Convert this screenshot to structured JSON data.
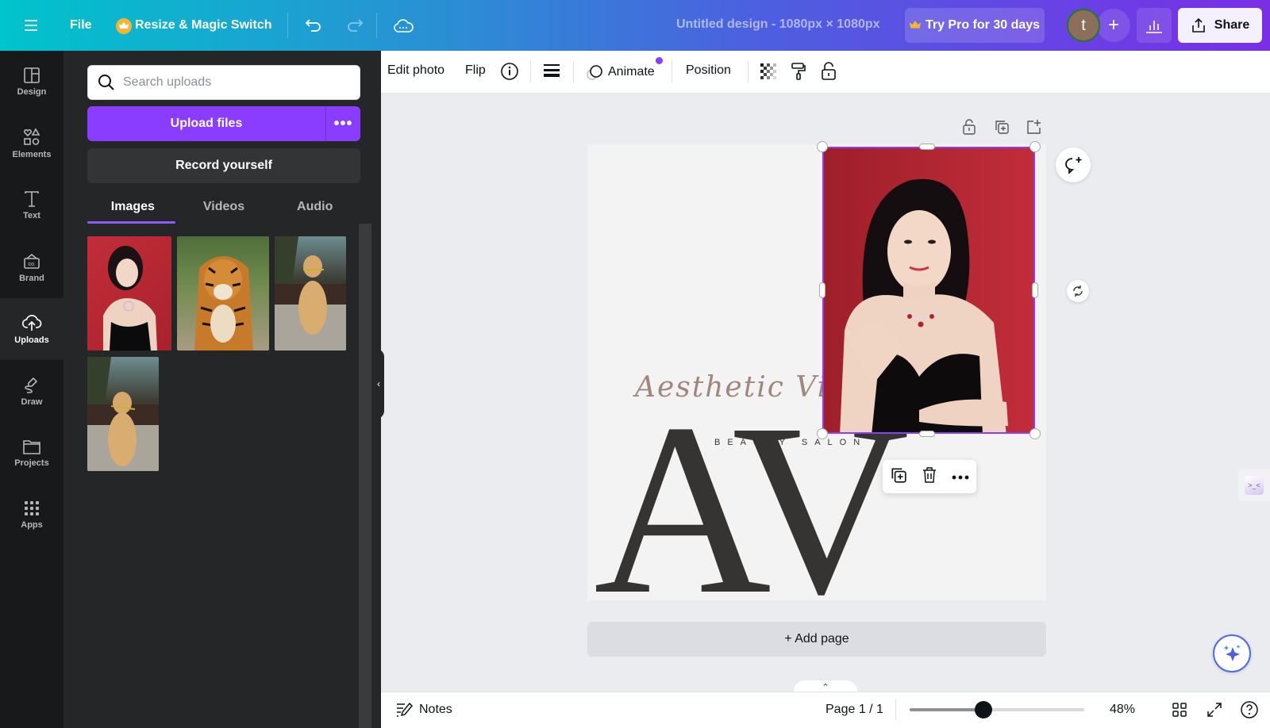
{
  "topbar": {
    "menu_icon": "hamburger-icon",
    "file_label": "File",
    "resize_label": "Resize & Magic Switch",
    "design_title": "Untitled design - 1080px × 1080px",
    "try_pro_label": "Try Pro for 30 days",
    "avatar_initial": "t",
    "add_label": "+",
    "share_label": "Share"
  },
  "leftnav": {
    "items": [
      {
        "label": "Design",
        "icon": "design-icon"
      },
      {
        "label": "Elements",
        "icon": "elements-icon"
      },
      {
        "label": "Text",
        "icon": "text-icon"
      },
      {
        "label": "Brand",
        "icon": "brand-icon"
      },
      {
        "label": "Uploads",
        "icon": "uploads-icon",
        "active": true
      },
      {
        "label": "Draw",
        "icon": "draw-icon"
      },
      {
        "label": "Projects",
        "icon": "projects-icon"
      },
      {
        "label": "Apps",
        "icon": "apps-icon"
      }
    ]
  },
  "panel": {
    "search_placeholder": "Search uploads",
    "search_value": "",
    "upload_label": "Upload files",
    "upload_more": "•••",
    "record_label": "Record yourself",
    "tabs": [
      {
        "label": "Images",
        "active": true
      },
      {
        "label": "Videos"
      },
      {
        "label": "Audio"
      }
    ],
    "images": [
      {
        "subject": "woman in black dress, red background"
      },
      {
        "subject": "tiger walking"
      },
      {
        "subject": "golden retriever with flower"
      },
      {
        "subject": "golden retriever with flower"
      }
    ]
  },
  "context_toolbar": {
    "edit_photo": "Edit photo",
    "flip": "Flip",
    "animate": "Animate",
    "position": "Position"
  },
  "canvas": {
    "script_text": "Aesthetic Villanueva",
    "monogram": "AV",
    "subtitle": "BEAUTY SALON",
    "add_page_label": "+ Add page"
  },
  "bottombar": {
    "notes_label": "Notes",
    "page_indicator": "Page 1 / 1",
    "zoom_value": 48,
    "zoom_label": "48%"
  },
  "colors": {
    "accent_purple": "#8b3dff",
    "panel_bg": "#252627",
    "nav_bg": "#18191b",
    "photo_red": "#b22a34"
  }
}
